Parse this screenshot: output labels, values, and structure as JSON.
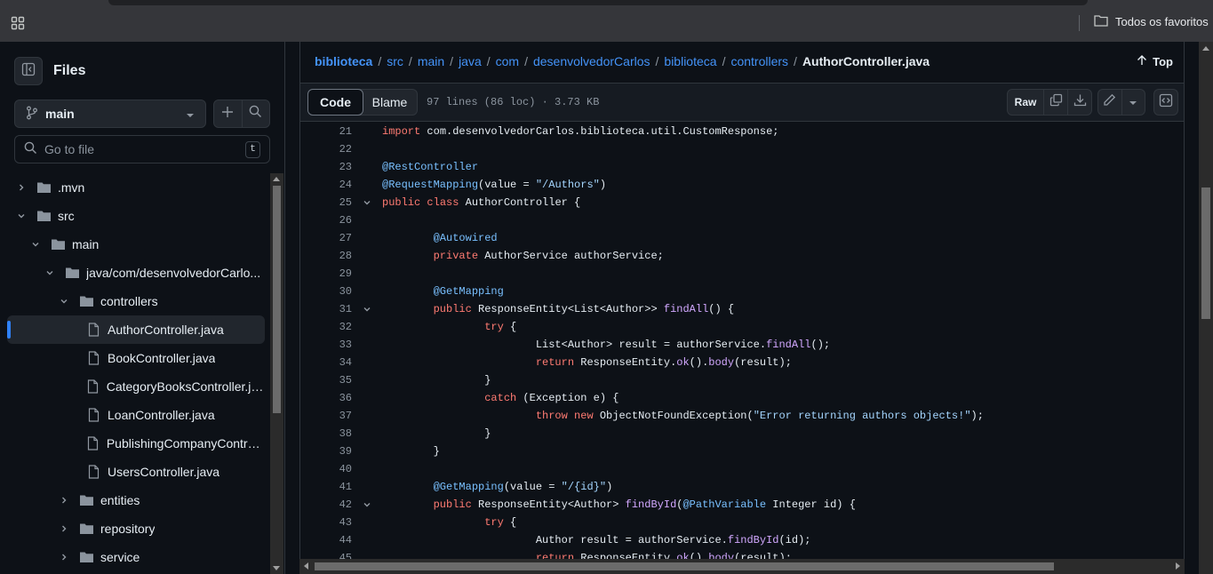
{
  "browser": {
    "bookmarks_label": "Todos os favoritos"
  },
  "sidebar": {
    "title": "Files",
    "branch": "main",
    "goto_placeholder": "Go to file",
    "goto_shortcut": "t",
    "tree": [
      {
        "label": ".mvn",
        "type": "folder",
        "depth": 0,
        "expanded": false
      },
      {
        "label": "src",
        "type": "folder",
        "depth": 0,
        "expanded": true
      },
      {
        "label": "main",
        "type": "folder",
        "depth": 1,
        "expanded": true
      },
      {
        "label": "java/com/desenvolvedorCarlo...",
        "type": "folder",
        "depth": 2,
        "expanded": true
      },
      {
        "label": "controllers",
        "type": "folder",
        "depth": 3,
        "expanded": true
      },
      {
        "label": "AuthorController.java",
        "type": "file",
        "depth": 4,
        "active": true
      },
      {
        "label": "BookController.java",
        "type": "file",
        "depth": 4
      },
      {
        "label": "CategoryBooksController.java",
        "type": "file",
        "depth": 4
      },
      {
        "label": "LoanController.java",
        "type": "file",
        "depth": 4
      },
      {
        "label": "PublishingCompanyControll...",
        "type": "file",
        "depth": 4
      },
      {
        "label": "UsersController.java",
        "type": "file",
        "depth": 4
      },
      {
        "label": "entities",
        "type": "folder",
        "depth": 3,
        "expanded": false
      },
      {
        "label": "repository",
        "type": "folder",
        "depth": 3,
        "expanded": false
      },
      {
        "label": "service",
        "type": "folder",
        "depth": 3,
        "expanded": false
      }
    ]
  },
  "breadcrumb": {
    "parts": [
      "biblioteca",
      "src",
      "main",
      "java",
      "com",
      "desenvolvedorCarlos",
      "biblioteca",
      "controllers"
    ],
    "file": "AuthorController.java",
    "top_label": "Top"
  },
  "filebar": {
    "code_tab": "Code",
    "blame_tab": "Blame",
    "meta": "97 lines (86 loc) · 3.73 KB",
    "raw_label": "Raw"
  },
  "code": [
    {
      "n": "21",
      "fold": false,
      "tokens": [
        [
          "k",
          "import"
        ],
        [
          "t",
          " com.desenvolvedorCarlos.biblioteca.util.CustomResponse;"
        ]
      ]
    },
    {
      "n": "22",
      "fold": false,
      "tokens": []
    },
    {
      "n": "23",
      "fold": false,
      "tokens": [
        [
          "a",
          "@RestController"
        ]
      ]
    },
    {
      "n": "24",
      "fold": false,
      "tokens": [
        [
          "a",
          "@RequestMapping"
        ],
        [
          "t",
          "(value = "
        ],
        [
          "s",
          "\"/Authors\""
        ],
        [
          "t",
          ")"
        ]
      ]
    },
    {
      "n": "25",
      "fold": true,
      "tokens": [
        [
          "k",
          "public"
        ],
        [
          "t",
          " "
        ],
        [
          "k",
          "class"
        ],
        [
          "t",
          " AuthorController {"
        ]
      ]
    },
    {
      "n": "26",
      "fold": false,
      "tokens": []
    },
    {
      "n": "27",
      "fold": false,
      "tokens": [
        [
          "t",
          "        "
        ],
        [
          "a",
          "@Autowired"
        ]
      ]
    },
    {
      "n": "28",
      "fold": false,
      "tokens": [
        [
          "t",
          "        "
        ],
        [
          "k",
          "private"
        ],
        [
          "t",
          " AuthorService authorService;"
        ]
      ]
    },
    {
      "n": "29",
      "fold": false,
      "tokens": []
    },
    {
      "n": "30",
      "fold": false,
      "tokens": [
        [
          "t",
          "        "
        ],
        [
          "a",
          "@GetMapping"
        ]
      ]
    },
    {
      "n": "31",
      "fold": true,
      "tokens": [
        [
          "t",
          "        "
        ],
        [
          "k",
          "public"
        ],
        [
          "t",
          " ResponseEntity<List<Author>> "
        ],
        [
          "f",
          "findAll"
        ],
        [
          "t",
          "() {"
        ]
      ]
    },
    {
      "n": "32",
      "fold": false,
      "tokens": [
        [
          "t",
          "                "
        ],
        [
          "k",
          "try"
        ],
        [
          "t",
          " {"
        ]
      ]
    },
    {
      "n": "33",
      "fold": false,
      "tokens": [
        [
          "t",
          "                        List<Author> result = authorService."
        ],
        [
          "f",
          "findAll"
        ],
        [
          "t",
          "();"
        ]
      ]
    },
    {
      "n": "34",
      "fold": false,
      "tokens": [
        [
          "t",
          "                        "
        ],
        [
          "k",
          "return"
        ],
        [
          "t",
          " ResponseEntity."
        ],
        [
          "f",
          "ok"
        ],
        [
          "t",
          "()."
        ],
        [
          "f",
          "body"
        ],
        [
          "t",
          "(result);"
        ]
      ]
    },
    {
      "n": "35",
      "fold": false,
      "tokens": [
        [
          "t",
          "                }"
        ]
      ]
    },
    {
      "n": "36",
      "fold": false,
      "tokens": [
        [
          "t",
          "                "
        ],
        [
          "k",
          "catch"
        ],
        [
          "t",
          " (Exception e) {"
        ]
      ]
    },
    {
      "n": "37",
      "fold": false,
      "tokens": [
        [
          "t",
          "                        "
        ],
        [
          "k",
          "throw"
        ],
        [
          "t",
          " "
        ],
        [
          "k",
          "new"
        ],
        [
          "t",
          " ObjectNotFoundException("
        ],
        [
          "s",
          "\"Error returning authors objects!\""
        ],
        [
          "t",
          ");"
        ]
      ]
    },
    {
      "n": "38",
      "fold": false,
      "tokens": [
        [
          "t",
          "                }"
        ]
      ]
    },
    {
      "n": "39",
      "fold": false,
      "tokens": [
        [
          "t",
          "        }"
        ]
      ]
    },
    {
      "n": "40",
      "fold": false,
      "tokens": []
    },
    {
      "n": "41",
      "fold": false,
      "tokens": [
        [
          "t",
          "        "
        ],
        [
          "a",
          "@GetMapping"
        ],
        [
          "t",
          "(value = "
        ],
        [
          "s",
          "\"/{id}\""
        ],
        [
          "t",
          ")"
        ]
      ]
    },
    {
      "n": "42",
      "fold": true,
      "tokens": [
        [
          "t",
          "        "
        ],
        [
          "k",
          "public"
        ],
        [
          "t",
          " ResponseEntity<Author> "
        ],
        [
          "f",
          "findById"
        ],
        [
          "t",
          "("
        ],
        [
          "a",
          "@PathVariable"
        ],
        [
          "t",
          " Integer id) {"
        ]
      ]
    },
    {
      "n": "43",
      "fold": false,
      "tokens": [
        [
          "t",
          "                "
        ],
        [
          "k",
          "try"
        ],
        [
          "t",
          " {"
        ]
      ]
    },
    {
      "n": "44",
      "fold": false,
      "tokens": [
        [
          "t",
          "                        Author result = authorService."
        ],
        [
          "f",
          "findById"
        ],
        [
          "t",
          "(id);"
        ]
      ]
    },
    {
      "n": "45",
      "fold": false,
      "tokens": [
        [
          "t",
          "                        "
        ],
        [
          "k",
          "return"
        ],
        [
          "t",
          " ResponseEntity."
        ],
        [
          "f",
          "ok"
        ],
        [
          "t",
          "()."
        ],
        [
          "f",
          "body"
        ],
        [
          "t",
          "(result);"
        ]
      ]
    }
  ],
  "icons": {
    "apps": "apps-grid-icon",
    "folder": "folder-icon",
    "file": "file-icon",
    "branch": "git-branch-icon"
  }
}
